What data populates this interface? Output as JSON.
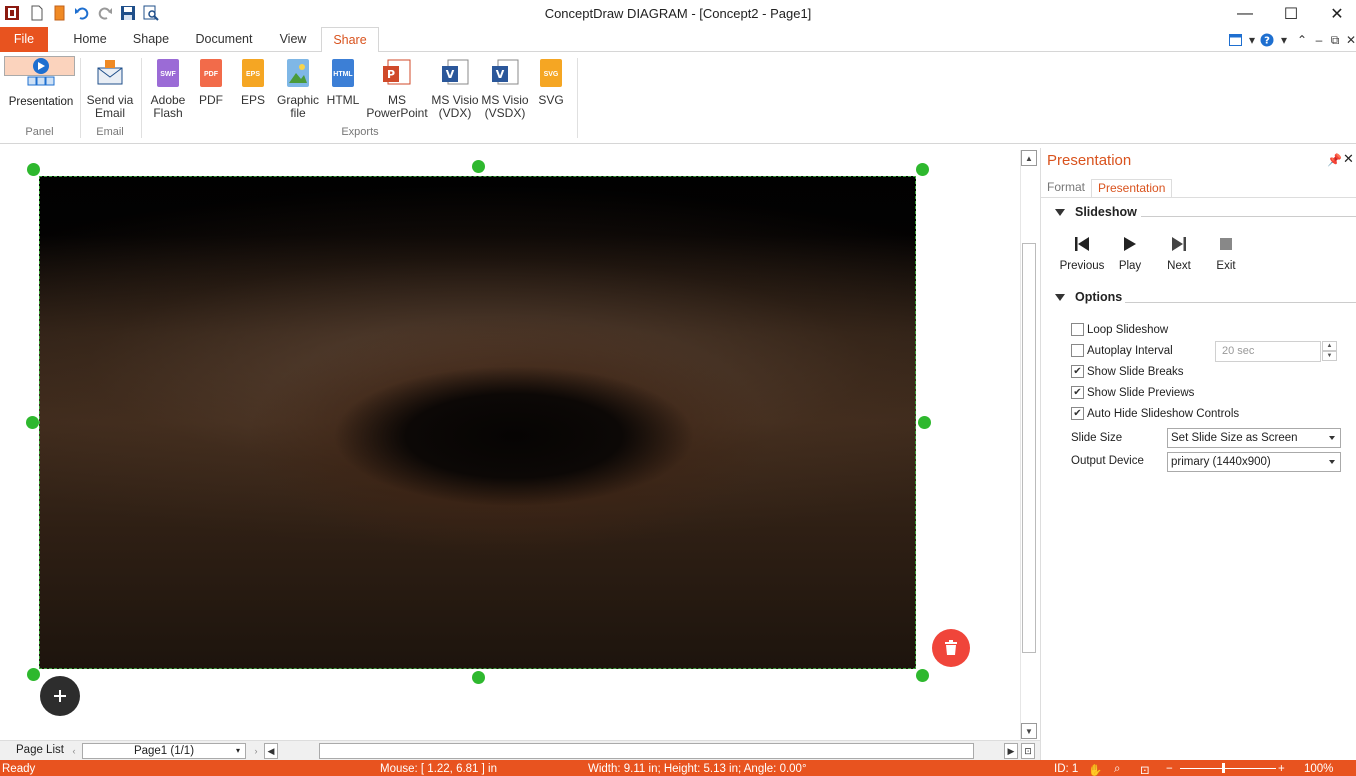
{
  "app": {
    "title": "ConceptDraw DIAGRAM - [Concept2 - Page1]"
  },
  "quick_access": {
    "icons": [
      "app-logo-icon",
      "new-file-icon",
      "open-file-icon",
      "undo-icon",
      "redo-icon",
      "save-icon",
      "print-preview-icon"
    ]
  },
  "window_controls": {
    "minimize": "—",
    "maximize": "☐",
    "close": "✕"
  },
  "ribbon_tabs": {
    "file": "File",
    "home": "Home",
    "shape": "Shape",
    "document": "Document",
    "view": "View",
    "share": "Share"
  },
  "ribbon": {
    "panel_group": {
      "label": "Panel",
      "presentation": "Presentation"
    },
    "email_group": {
      "label": "Email",
      "send_line1": "Send via",
      "send_line2": "Email"
    },
    "exports_group": {
      "label": "Exports",
      "adobe_line1": "Adobe",
      "adobe_line2": "Flash",
      "adobe_badge": "SWF",
      "pdf": "PDF",
      "pdf_badge": "PDF",
      "eps": "EPS",
      "eps_badge": "EPS",
      "graphic_line1": "Graphic",
      "graphic_line2": "file",
      "html": "HTML",
      "html_badge": "HTML",
      "ppt_line1": "MS",
      "ppt_line2": "PowerPoint",
      "vdx_line1": "MS Visio",
      "vdx_line2": "(VDX)",
      "vsdx_line1": "MS Visio",
      "vsdx_line2": "(VSDX)",
      "svg": "SVG",
      "svg_badge": "SVG"
    }
  },
  "panel": {
    "title": "Presentation",
    "tabs": {
      "format": "Format",
      "presentation": "Presentation"
    },
    "slideshow": {
      "heading": "Slideshow",
      "previous": "Previous",
      "play": "Play",
      "next": "Next",
      "exit": "Exit"
    },
    "options": {
      "heading": "Options",
      "loop_slideshow": {
        "label": "Loop Slideshow",
        "checked": false
      },
      "autoplay_interval": {
        "label": "Autoplay Interval",
        "checked": false,
        "value": "20  sec"
      },
      "show_slide_breaks": {
        "label": "Show Slide Breaks",
        "checked": true
      },
      "show_slide_previews": {
        "label": "Show Slide Previews",
        "checked": true
      },
      "auto_hide_controls": {
        "label": "Auto Hide Slideshow Controls",
        "checked": true
      },
      "slide_size_label": "Slide Size",
      "slide_size_value": "Set Slide Size as Screen",
      "output_device_label": "Output Device",
      "output_device_value": "primary (1440x900)"
    }
  },
  "page_bar": {
    "label": "Page List",
    "current_page": "Page1 (1/1)"
  },
  "status": {
    "ready": "Ready",
    "mouse": "Mouse: [ 1.22, 6.81 ] in",
    "size": "Width: 9.11 in;  Height: 5.13 in;  Angle: 0.00°",
    "id": "ID: 1",
    "zoom": "100%"
  },
  "colors": {
    "accent": "#e8531f",
    "selection": "#2eb82e",
    "delete": "#f0453a"
  }
}
